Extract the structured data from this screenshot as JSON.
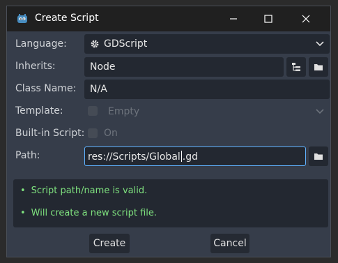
{
  "window": {
    "title": "Create Script"
  },
  "form": {
    "language": {
      "label": "Language:",
      "value": "GDScript"
    },
    "inherits": {
      "label": "Inherits:",
      "value": "Node"
    },
    "class_name": {
      "label": "Class Name:",
      "value": "N/A"
    },
    "template": {
      "label": "Template:",
      "value": "Empty"
    },
    "built_in": {
      "label": "Built-in Script:",
      "value": "On"
    },
    "path": {
      "label": "Path:",
      "value_before_cursor": "res://Scripts/Global",
      "value_after_cursor": ".gd"
    }
  },
  "status": {
    "bullet": "•",
    "messages": [
      "Script path/name is valid.",
      "Will create a new script file."
    ]
  },
  "buttons": {
    "create": "Create",
    "cancel": "Cancel"
  },
  "colors": {
    "accent": "#5fb2ff",
    "success": "#7ee07e",
    "panel": "#232831",
    "window_bg": "#363d4a"
  }
}
